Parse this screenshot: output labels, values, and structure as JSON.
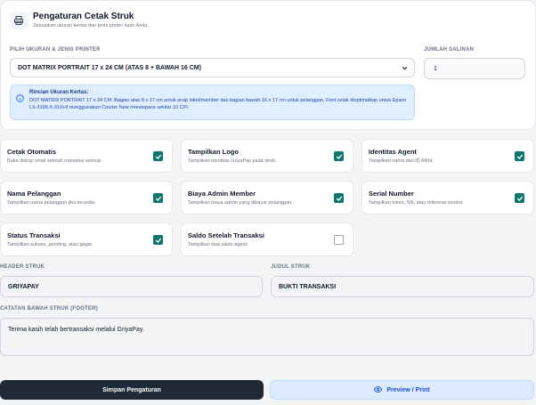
{
  "header": {
    "title": "Pengaturan Cetak Struk",
    "subtitle": "Sesuaikan ukuran kertas dan jenis printer kasir Anda.",
    "icon": "printer-icon"
  },
  "paper": {
    "label": "PILIH UKURAN & JENIS PRINTER",
    "selected": "DOT MATRIX PORTRAIT 17 x 24 CM (ATAS 8 + BAWAH 16 CM)"
  },
  "copies": {
    "label": "JUMLAH SALINAN",
    "value": "1"
  },
  "info": {
    "title": "Rincian Ukuran Kertas:",
    "body": "DOT MATRIX PORTRAIT 17 x 24 CM. Bagian atas 8 x 17 cm untuk arsip loket/member dan bagian bawah 16 x 17 cm untuk pelanggan. Font cetak dioptimalkan untuk Epson LX-310/LX-310+II menggunakan Courier New monospace sekitar 10 CPI."
  },
  "options": [
    {
      "title": "Cetak Otomatis",
      "desc": "Buka dialog cetak setelah transaksi selesai.",
      "checked": true
    },
    {
      "title": "Tampilkan Logo",
      "desc": "Tampilkan identitas GriyaPay pada struk.",
      "checked": true
    },
    {
      "title": "Identitas Agent",
      "desc": "Tampilkan nama dan ID Mitra.",
      "checked": true
    },
    {
      "title": "Nama Pelanggan",
      "desc": "Tampilkan nama pelanggan jika tersedia.",
      "checked": true
    },
    {
      "title": "Biaya Admin Member",
      "desc": "Tampilkan biaya admin yang dibayar pelanggan.",
      "checked": true
    },
    {
      "title": "Serial Number",
      "desc": "Tampilkan token, SN, atau referensi vendor.",
      "checked": true
    },
    {
      "title": "Status Transaksi",
      "desc": "Tampilkan sukses, pending, atau gagal.",
      "checked": true
    },
    {
      "title": "Saldo Setelah Transaksi",
      "desc": "Tampilkan sisa saldo agent.",
      "checked": false
    }
  ],
  "header_struk": {
    "label": "HEADER STRUK",
    "value": "GRIYAPAY"
  },
  "judul_struk": {
    "label": "JUDUL STRUK",
    "value": "BUKTI TRANSAKSI"
  },
  "footer": {
    "label": "CATATAN BAWAH STRUK (FOOTER)",
    "value": "Terima kasih telah bertransaksi melalui GriyaPay."
  },
  "buttons": {
    "save": "Simpan Pengaturan",
    "preview": "Preview / Print"
  },
  "colors": {
    "checkbox_on": "#0f766e",
    "primary_button": "#1f2937",
    "secondary_button": "#dbeafe"
  }
}
